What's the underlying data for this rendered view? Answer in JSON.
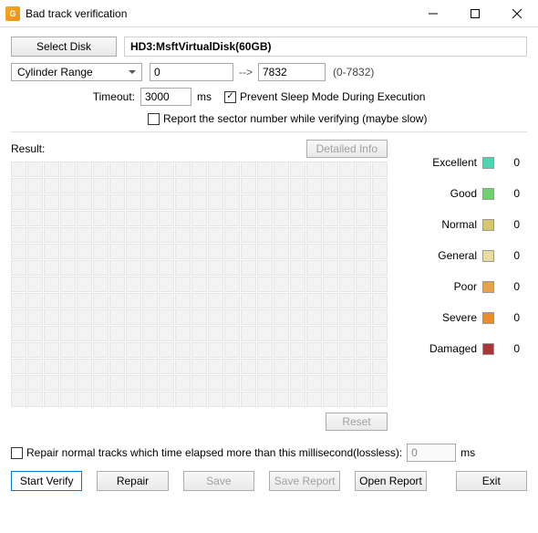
{
  "window": {
    "title": "Bad track verification",
    "icon_glyph": "G"
  },
  "toolbar": {
    "select_disk": "Select Disk",
    "disk": "HD3:MsftVirtualDisk(60GB)"
  },
  "cylinder": {
    "label": "Cylinder Range",
    "from": "0",
    "to": "7832",
    "arrow": "-->",
    "range_hint": "(0-7832)"
  },
  "timeout": {
    "label": "Timeout:",
    "value": "3000",
    "unit": "ms"
  },
  "options": {
    "prevent_sleep": {
      "checked": true,
      "label": "Prevent Sleep Mode During Execution"
    },
    "report_sector": {
      "checked": false,
      "label": "Report the sector number while verifying (maybe slow)"
    }
  },
  "result": {
    "label": "Result:",
    "detailed_info": "Detailed Info",
    "reset": "Reset"
  },
  "legend": [
    {
      "label": "Excellent",
      "color": "#4fd4b2",
      "count": "0"
    },
    {
      "label": "Good",
      "color": "#6fd26f",
      "count": "0"
    },
    {
      "label": "Normal",
      "color": "#d6c66c",
      "count": "0"
    },
    {
      "label": "General",
      "color": "#e8dca0",
      "count": "0"
    },
    {
      "label": "Poor",
      "color": "#e8a04a",
      "count": "0"
    },
    {
      "label": "Severe",
      "color": "#e88c2e",
      "count": "0"
    },
    {
      "label": "Damaged",
      "color": "#a83838",
      "count": "0"
    }
  ],
  "repair": {
    "checked": false,
    "label": "Repair normal tracks which time elapsed more than this millisecond(lossless):",
    "value": "0",
    "unit": "ms"
  },
  "buttons": {
    "start_verify": "Start Verify",
    "repair": "Repair",
    "save": "Save",
    "save_report": "Save Report",
    "open_report": "Open Report",
    "exit": "Exit"
  }
}
